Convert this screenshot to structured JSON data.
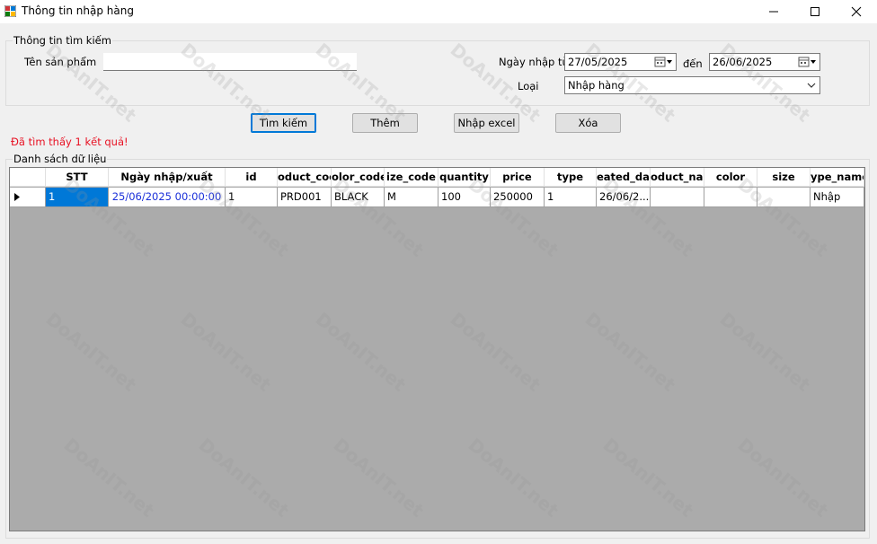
{
  "window": {
    "title": "Thông tin nhập hàng"
  },
  "search_group": {
    "title": "Thông tin tìm kiếm",
    "product_name_label": "Tên sản phẩm",
    "product_name_value": "",
    "date_from_label": "Ngày nhập từ",
    "date_from_value": "27/05/2025",
    "date_to_label": "đến",
    "date_to_value": "26/06/2025",
    "type_label": "Loại",
    "type_value": "Nhập hàng"
  },
  "buttons": {
    "search": "Tìm kiếm",
    "add": "Thêm",
    "import_excel": "Nhập excel",
    "delete": "Xóa"
  },
  "status_text": "Đã tìm thấy 1 kết quả!",
  "data_group": {
    "title": "Danh sách dữ liệu"
  },
  "table": {
    "columns": [
      "STT",
      "Ngày nhập/xuất",
      "id",
      "oduct_coc",
      "olor_code",
      "ize_code",
      "quantity",
      "price",
      "type",
      "eated_dat",
      "oduct_nan",
      "color",
      "size",
      "ype_name"
    ],
    "rows": [
      [
        "1",
        "25/06/2025 00:00:00",
        "1",
        "PRD001",
        "BLACK",
        "M",
        "100",
        "250000",
        "1",
        "26/06/2...",
        "",
        "",
        "",
        "Nhập"
      ]
    ]
  },
  "watermark": "DoAnIT.net",
  "colors": {
    "selection": "#0078d7",
    "status": "#e81123",
    "date_text": "#1a2fd9",
    "grid_bg": "#ababab"
  }
}
